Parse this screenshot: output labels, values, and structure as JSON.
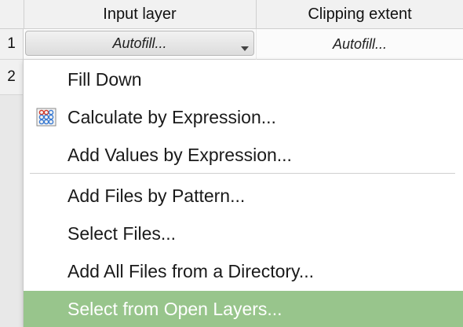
{
  "table": {
    "columns": [
      "Input layer",
      "Clipping extent"
    ],
    "rows": [
      {
        "number": "1",
        "input_layer": "Autofill...",
        "clipping_extent": "Autofill..."
      },
      {
        "number": "2"
      }
    ]
  },
  "context_menu": {
    "items": [
      {
        "label": "Fill Down",
        "icon": null
      },
      {
        "label": "Calculate by Expression...",
        "icon": "calculator-icon"
      },
      {
        "label": "Add Values by Expression...",
        "icon": null
      },
      {
        "label": "Add Files by Pattern...",
        "icon": null
      },
      {
        "label": "Select Files...",
        "icon": null
      },
      {
        "label": "Add All Files from a Directory...",
        "icon": null
      },
      {
        "label": "Select from Open Layers...",
        "icon": null,
        "highlighted": true
      }
    ]
  },
  "colors": {
    "highlight": "#98c58c",
    "menu_bg": "#ffffff",
    "header_bg": "#f1f1f1"
  }
}
